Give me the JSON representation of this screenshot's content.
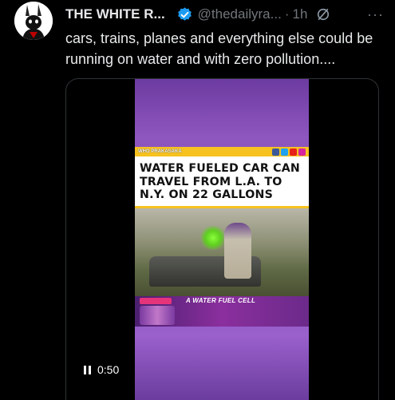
{
  "author": {
    "avatar_icon": "rabbit-avatar-icon",
    "display_name": "THE WHITE R...",
    "verified": true,
    "handle": "@thedailyra...",
    "separator": "·",
    "time": "1h",
    "grok_icon": "grok-icon",
    "more_label": "···"
  },
  "tweet": {
    "text": "cars, trains, planes and everything else could be running on water and with zero pollution...."
  },
  "video": {
    "channel_label": "WHO PRAKASAKA",
    "headline": "WATER FUELED CAR CAN TRAVEL FROM L.A. TO N.Y. ON 22 GALLONS",
    "caption": "A WATER FUEL CELL",
    "social_icons": [
      "facebook-icon",
      "twitter-icon",
      "youtube-icon",
      "instagram-icon"
    ],
    "duration": "0:50",
    "state": "paused",
    "colors": {
      "accent_yellow": "#f7c21f",
      "purple": "#8e56bf",
      "verified_blue": "#1d9bf0"
    }
  }
}
